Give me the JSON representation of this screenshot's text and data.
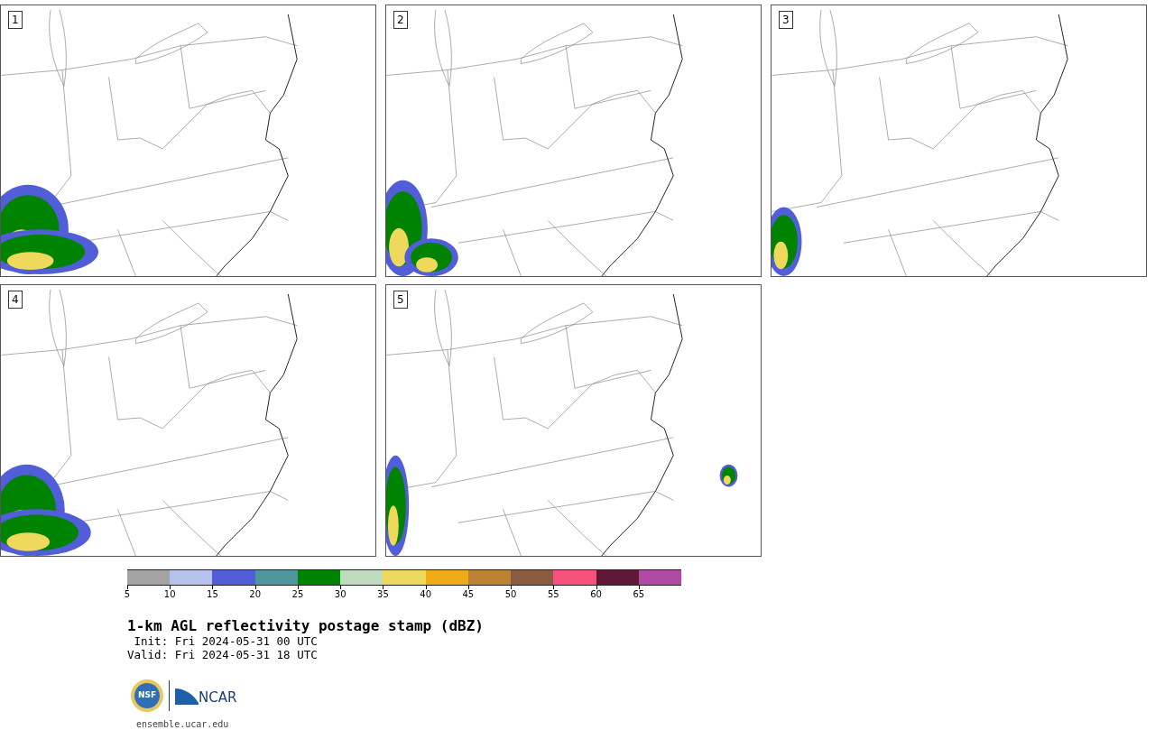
{
  "panels": [
    {
      "label": "1"
    },
    {
      "label": "2"
    },
    {
      "label": "3"
    },
    {
      "label": "4"
    },
    {
      "label": "5"
    }
  ],
  "colorbar": {
    "bins": [
      {
        "label": "5",
        "color": "#a4a4a4"
      },
      {
        "label": "10",
        "color": "#b6c1ec"
      },
      {
        "label": "15",
        "color": "#525ed8"
      },
      {
        "label": "20",
        "color": "#4e959c"
      },
      {
        "label": "25",
        "color": "#008300"
      },
      {
        "label": "30",
        "color": "#bedcbc"
      },
      {
        "label": "35",
        "color": "#efd95c"
      },
      {
        "label": "40",
        "color": "#efac18"
      },
      {
        "label": "45",
        "color": "#bb8333"
      },
      {
        "label": "50",
        "color": "#8a5b3f"
      },
      {
        "label": "55",
        "color": "#f5517c"
      },
      {
        "label": "60",
        "color": "#601733"
      },
      {
        "label": "65",
        "color": "#ae4aa2"
      }
    ]
  },
  "title": "1-km AGL reflectivity postage stamp (dBZ)",
  "init": " Init: Fri 2024-05-31 00 UTC",
  "valid": "Valid: Fri 2024-05-31 18 UTC",
  "logos": {
    "nsf": "NSF",
    "ncar": "NCAR"
  },
  "footer": "ensemble.ucar.edu"
}
